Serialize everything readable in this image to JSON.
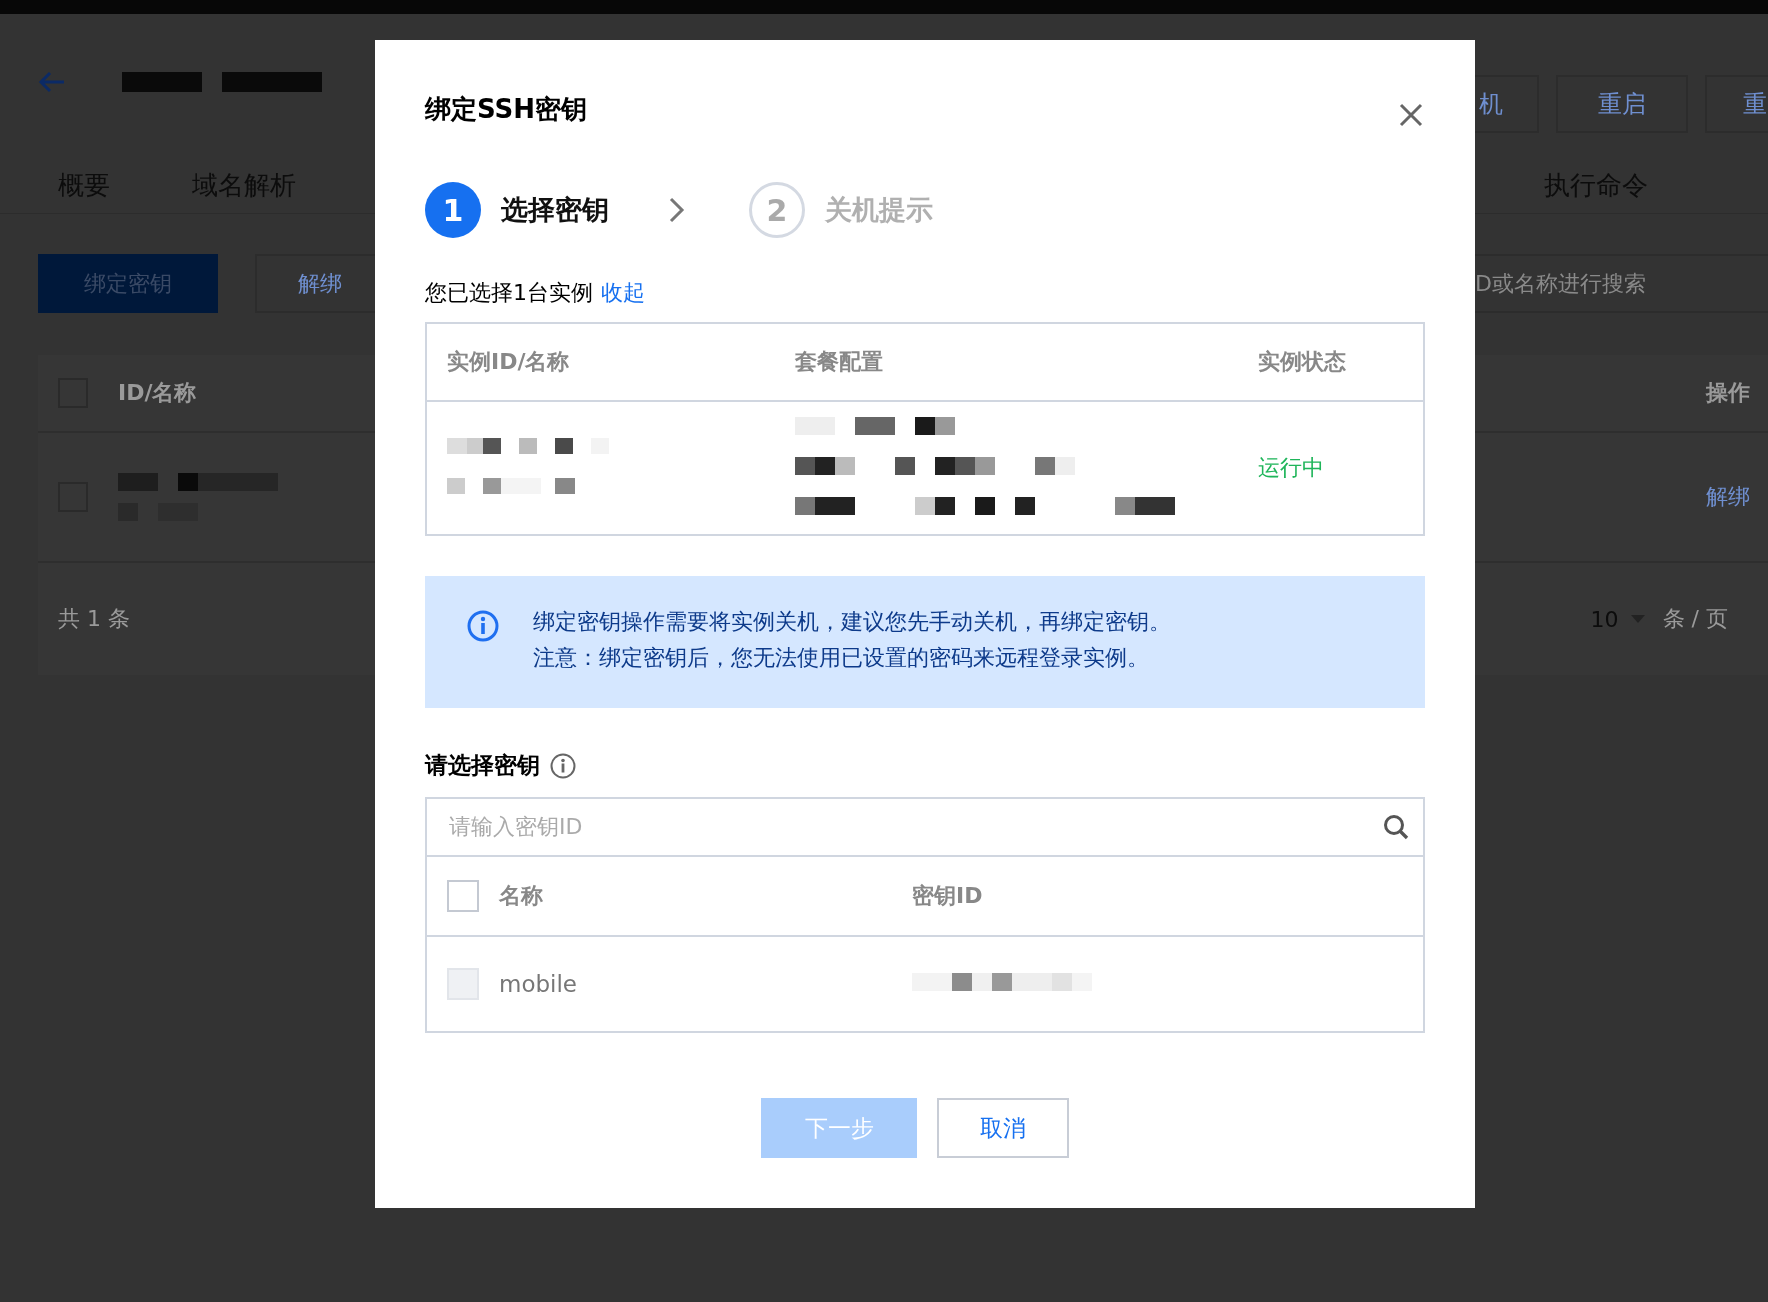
{
  "background": {
    "top_buttons": [
      "机",
      "重启",
      "重"
    ],
    "tabs": [
      {
        "label": "概要"
      },
      {
        "label": "域名解析"
      },
      {
        "label": "执行命令"
      }
    ],
    "toolbar": {
      "buttons": [
        {
          "label": "绑定密钥",
          "kind": "primary"
        },
        {
          "label": "解绑",
          "kind": "outline"
        }
      ],
      "search": {
        "placeholder": "D或名称进行搜索"
      }
    },
    "table": {
      "columns": [
        "ID/名称",
        "操作"
      ],
      "select_all": {
        "checked": false
      },
      "rows": [
        {
          "action": "解绑",
          "checked": false
        }
      ],
      "footer": {
        "total": "共 1 条",
        "page_size": "10",
        "per_page": "条 / 页"
      }
    }
  },
  "dialog": {
    "title": "绑定SSH密钥",
    "steps": [
      {
        "number": "1",
        "label": "选择密钥",
        "active": true
      },
      {
        "number": "2",
        "label": "关机提示",
        "active": false
      }
    ],
    "selection": {
      "text": "您已选择1台实例",
      "link": "收起"
    },
    "instances": {
      "columns": [
        "实例ID/名称",
        "套餐配置",
        "实例状态"
      ],
      "rows": [
        {
          "status": "运行中"
        }
      ]
    },
    "notice": {
      "lines": [
        "绑定密钥操作需要将实例关机，建议您先手动关机，再绑定密钥。",
        "注意：绑定密钥后，您无法使用已设置的密码来远程登录实例。"
      ]
    },
    "key_section": {
      "label": "请选择密钥",
      "search": {
        "placeholder": "请输入密钥ID"
      },
      "columns": [
        "名称",
        "密钥ID"
      ],
      "select_all": {
        "checked": false
      },
      "rows": [
        {
          "name": "mobile",
          "checked": false,
          "disabled": true
        }
      ]
    },
    "buttons": [
      {
        "label": "下一步",
        "kind": "primary",
        "disabled": true
      },
      {
        "label": "取消",
        "kind": "default",
        "disabled": false
      }
    ]
  }
}
